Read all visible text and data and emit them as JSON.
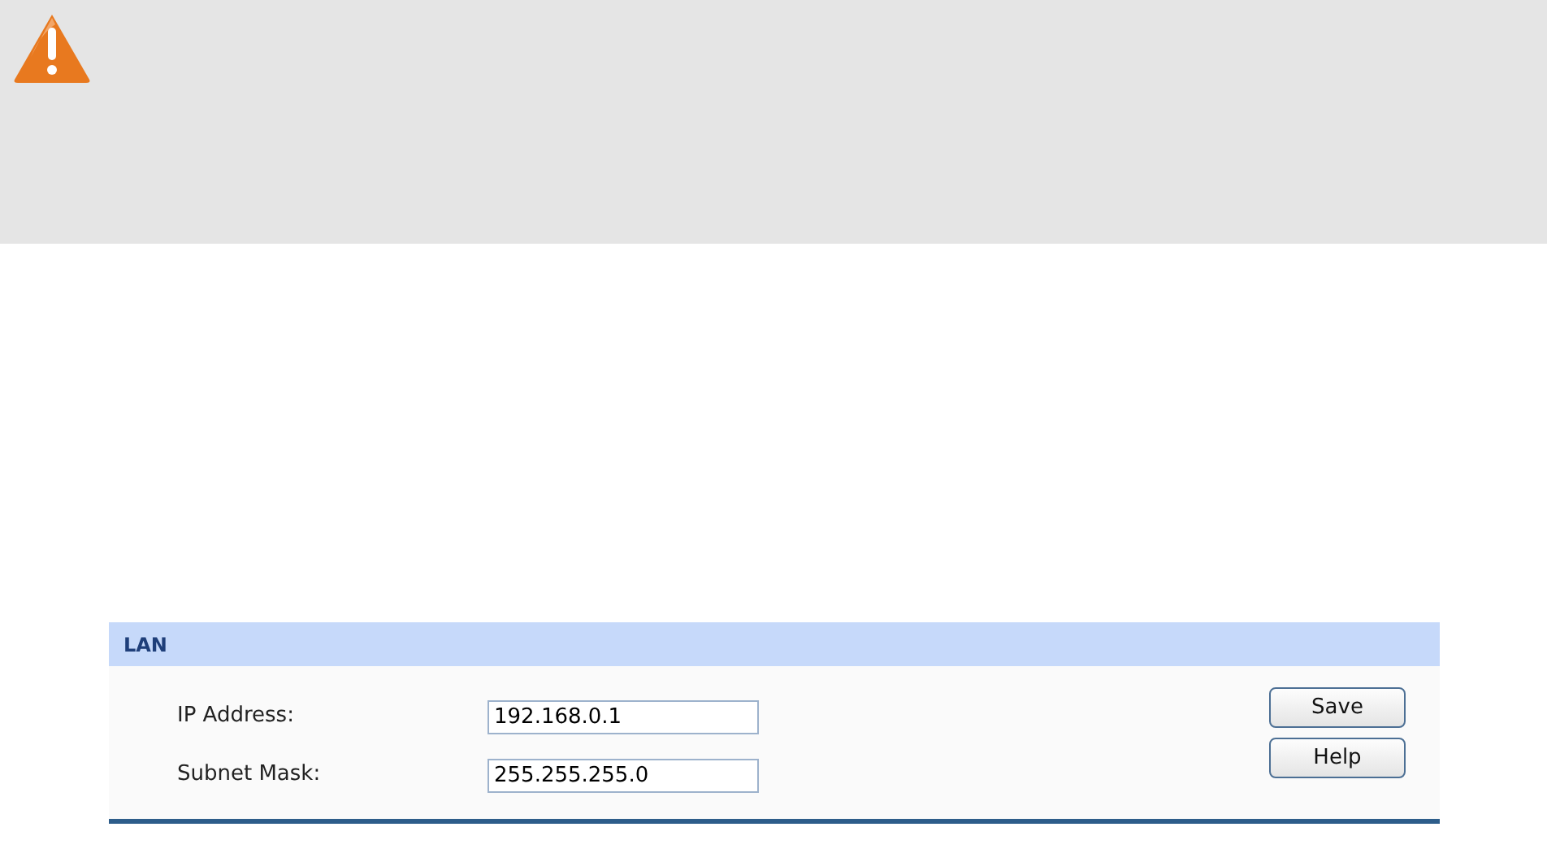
{
  "warning_panel": {
    "kind": "warning"
  },
  "lan": {
    "title": "LAN",
    "fields": [
      {
        "label": "IP Address:",
        "value": "192.168.0.1"
      },
      {
        "label": "Subnet Mask:",
        "value": "255.255.255.0"
      }
    ],
    "buttons": [
      "Save",
      "Help"
    ]
  }
}
